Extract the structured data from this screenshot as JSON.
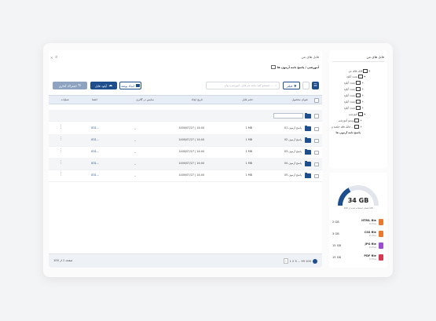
{
  "sidebar": {
    "title": "فایل های من",
    "tree": [
      {
        "label": "فایل های من",
        "prefix": "▾"
      },
      {
        "label": "تست آپلود",
        "prefix": "▾"
      },
      {
        "label": "تست آپلود",
        "prefix": "+"
      },
      {
        "label": "تست آپلود",
        "prefix": "+"
      },
      {
        "label": "تست آپلود",
        "prefix": "+"
      },
      {
        "label": "تست آپلود",
        "prefix": "+"
      },
      {
        "label": "تست آپلود",
        "prefix": "+"
      },
      {
        "label": "آموزشی",
        "prefix": "▾"
      },
      {
        "label": "ویدیو آموزشی",
        "prefix": "+"
      },
      {
        "label": "فایل های جلسه و ...",
        "prefix": "+"
      },
      {
        "label": "پاسخ نامه آزمون ها",
        "prefix": ""
      }
    ]
  },
  "storage": {
    "total": "34 GB",
    "caption": "فضای استفاده شده از 100 GB",
    "used_fraction": 0.34,
    "files": [
      {
        "type": "HTML file",
        "sub": "10 files",
        "size": "2 GB",
        "color": "#e8792f"
      },
      {
        "type": "CSS file",
        "sub": "15 files",
        "size": "3 GB",
        "color": "#e8792f"
      },
      {
        "type": "JPG file",
        "sub": "24 files",
        "size": "15 GB",
        "color": "#9b4fd0"
      },
      {
        "type": "PDF file",
        "sub": "12 files",
        "size": "15 GB",
        "color": "#d83a52"
      }
    ]
  },
  "main": {
    "header_title": "فایل های من",
    "breadcrumb": "آموزشی / پاسخ نامه آزمون ها",
    "breadcrumb_bold": "پاسخ نامه آزمون ها",
    "search_placeholder": "جستجو کنید مانند نام فایل، آموزشی، پیام ...",
    "filter_label": "فیلتر",
    "buttons": {
      "new_folder": "ایجاد پوشه",
      "upload": "آپلود فایل",
      "share": "اشتراک گذاری"
    },
    "columns": [
      "عنوان محصول",
      "حجم فایل",
      "تاریخ ایجاد",
      "نمایش در گالری",
      "اعضا",
      "عملیات"
    ],
    "rows": [
      {
        "name": "پاسخ آزمون 01",
        "size": "1 MB",
        "date": "1400/07/27 | 14:40",
        "gallery": "_",
        "members": "831..."
      },
      {
        "name": "پاسخ آزمون 02",
        "size": "1 MB",
        "date": "1400/07/27 | 14:40",
        "gallery": "_",
        "members": "831..."
      },
      {
        "name": "پاسخ آزمون 03",
        "size": "1 MB",
        "date": "1400/07/27 | 14:40",
        "gallery": "_",
        "members": "831..."
      },
      {
        "name": "پاسخ آزمون 04",
        "size": "1 MB",
        "date": "1400/07/27 | 14:40",
        "gallery": "_",
        "members": "831..."
      },
      {
        "name": "پاسخ آزمون 05",
        "size": "1 MB",
        "date": "1400/07/27 | 14:40",
        "gallery": "_",
        "members": "831..."
      }
    ],
    "footer": {
      "page_info": "صفحه 1 از 100",
      "pages": "1  2  3 ... 99  100"
    }
  }
}
